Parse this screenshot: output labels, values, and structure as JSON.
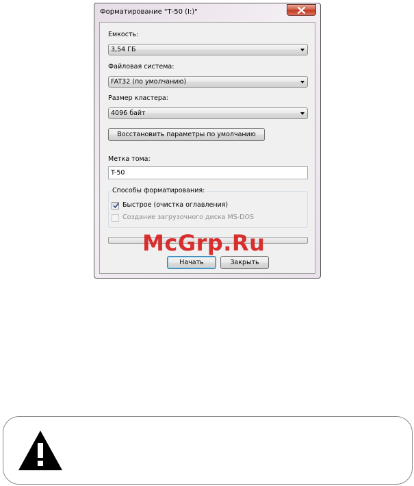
{
  "dialog": {
    "title": "Форматирование \"Т-50 (I:)\"",
    "capacity": {
      "label": "Емкость:",
      "value": "3,54 ГБ"
    },
    "filesystem": {
      "label": "Файловая система:",
      "value": "FAT32 (по умолчанию)"
    },
    "cluster": {
      "label": "Размер кластера:",
      "value": "4096 байт"
    },
    "restore_button": "Восстановить параметры по умолчанию",
    "volume_label": {
      "label": "Метка тома:",
      "value": "T-50"
    },
    "format_options": {
      "legend": "Способы форматирования:",
      "quick": {
        "label": "Быстрое (очистка оглавления)",
        "checked": true
      },
      "msdos": {
        "label": "Создание загрузочного диска MS-DOS",
        "checked": false,
        "disabled": true
      }
    },
    "progress": 0,
    "start_button": "Начать",
    "close_button": "Закрыть"
  },
  "watermark": "McGrp.Ru",
  "warning": {
    "icon": "warning-triangle-icon"
  },
  "colors": {
    "close_button": "#c23a22",
    "watermark": "#d61e1e",
    "default_button_border": "#3c7fb1"
  }
}
